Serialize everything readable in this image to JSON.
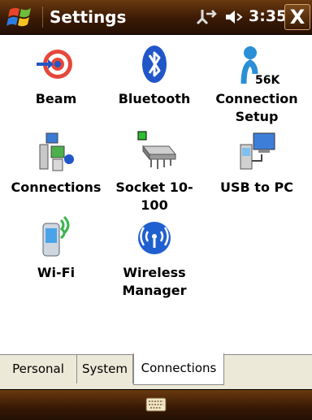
{
  "titlebar": {
    "title": "Settings",
    "time": "3:35",
    "close_label": "X",
    "icons": [
      "start-icon",
      "connectivity-icon",
      "volume-icon"
    ]
  },
  "items": [
    {
      "label_lines": [
        "Beam"
      ],
      "icon": "beam-icon"
    },
    {
      "label_lines": [
        "Bluetooth"
      ],
      "icon": "bluetooth-icon"
    },
    {
      "label_lines": [
        "Connection",
        "Setup"
      ],
      "icon": "connection-setup-icon",
      "icon_text": "56K"
    },
    {
      "label_lines": [
        "Connections"
      ],
      "icon": "connections-icon"
    },
    {
      "label_lines": [
        "Socket 10-",
        "100"
      ],
      "icon": "network-card-icon"
    },
    {
      "label_lines": [
        "USB to PC"
      ],
      "icon": "usb-to-pc-icon"
    },
    {
      "label_lines": [
        "Wi-Fi"
      ],
      "icon": "wifi-icon"
    },
    {
      "label_lines": [
        "Wireless",
        "Manager"
      ],
      "icon": "wireless-manager-icon"
    }
  ],
  "tabs": [
    {
      "label": "Personal",
      "active": false
    },
    {
      "label": "System",
      "active": false
    },
    {
      "label": "Connections",
      "active": true
    }
  ],
  "menubar": {
    "icon": "keyboard-icon"
  },
  "colors": {
    "bar_dark": "#241003",
    "bar_light": "#6a3a10",
    "tab_bg": "#ece9d8"
  }
}
